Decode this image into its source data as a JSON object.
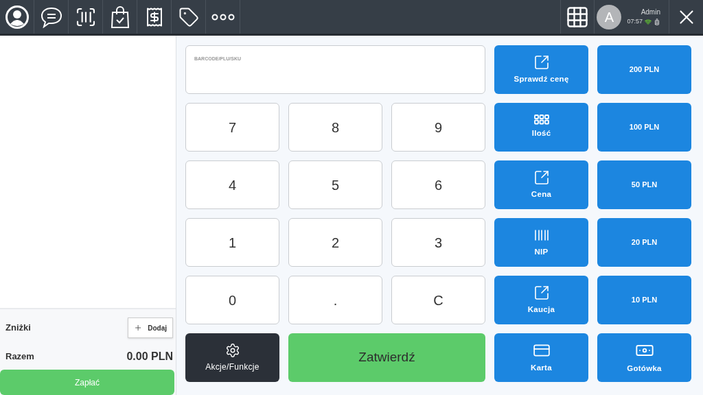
{
  "status": {
    "initial": "A",
    "user": "Admin",
    "time": "07:57"
  },
  "cart": {
    "discounts_label": "Zniżki",
    "add_button": "Dodaj",
    "total_label": "Razem",
    "total": "0.00 PLN",
    "pay_button": "Zapłać"
  },
  "entry": {
    "label": "BARCODE/PLU/SKU"
  },
  "pad": [
    {
      "kind": "action",
      "label": "Sprawdź cenę"
    },
    {
      "kind": "amount",
      "label": "200 PLN"
    },
    {
      "kind": "key",
      "label": "7"
    },
    {
      "kind": "key",
      "label": "8"
    },
    {
      "kind": "key",
      "label": "9"
    },
    {
      "kind": "action",
      "label": "Ilość"
    },
    {
      "kind": "amount",
      "label": "100 PLN"
    },
    {
      "kind": "key",
      "label": "4"
    },
    {
      "kind": "key",
      "label": "5"
    },
    {
      "kind": "key",
      "label": "6"
    },
    {
      "kind": "action",
      "label": "Cena"
    },
    {
      "kind": "amount",
      "label": "50 PLN"
    },
    {
      "kind": "key",
      "label": "1"
    },
    {
      "kind": "key",
      "label": "2"
    },
    {
      "kind": "key",
      "label": "3"
    },
    {
      "kind": "action",
      "label": "NIP"
    },
    {
      "kind": "amount",
      "label": "20 PLN"
    },
    {
      "kind": "key",
      "label": "0"
    },
    {
      "kind": "key",
      "label": "."
    },
    {
      "kind": "key",
      "label": "C"
    },
    {
      "kind": "action",
      "label": "Kaucja"
    },
    {
      "kind": "amount",
      "label": "10 PLN"
    },
    {
      "kind": "menu",
      "label": "Akcje/Funkcje"
    },
    {
      "kind": "confirm",
      "label": "Zatwierdź"
    },
    {
      "kind": "action",
      "label": "Karta"
    },
    {
      "kind": "action",
      "label": "Gotówka"
    }
  ]
}
